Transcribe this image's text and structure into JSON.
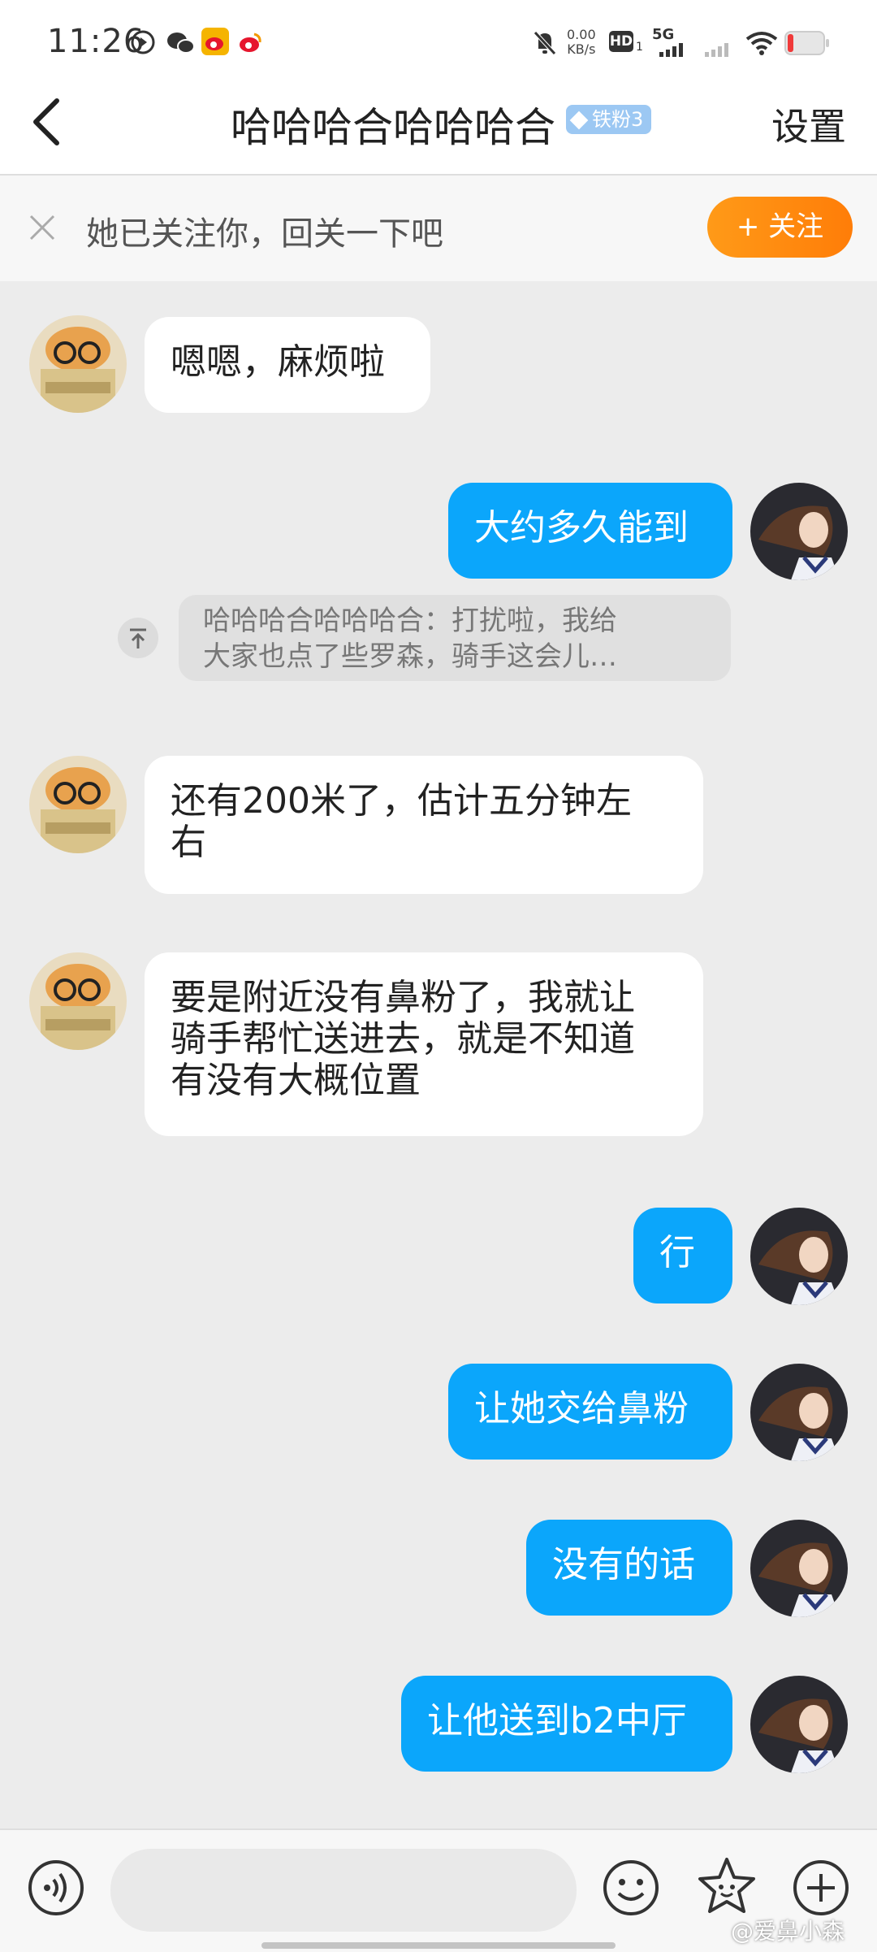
{
  "status_bar": {
    "time": "11:26",
    "net_speed_value": "0.00",
    "net_speed_unit": "KB/s",
    "hd_label": "HD",
    "hd_sub": "1",
    "network": "5G"
  },
  "header": {
    "title": "哈哈哈合哈哈哈合",
    "badge": "铁粉3",
    "settings_label": "设置"
  },
  "follow_banner": {
    "text": "她已关注你，回关一下吧",
    "button_label": "+ 关注"
  },
  "messages": [
    {
      "side": "left",
      "text": "嗯嗯，麻烦啦"
    },
    {
      "side": "right",
      "text": "大约多久能到"
    },
    {
      "side": "quote",
      "text_line1": "哈哈哈合哈哈哈合：打扰啦，我给",
      "text_line2": "大家也点了些罗森，骑手这会儿…"
    },
    {
      "side": "left",
      "text_line1": "还有200米了，估计五分钟左",
      "text_line2": "右"
    },
    {
      "side": "left",
      "text_line1": "要是附近没有鼻粉了，我就让",
      "text_line2": "骑手帮忙送进去，就是不知道",
      "text_line3": "有没有大概位置"
    },
    {
      "side": "right",
      "text": "行"
    },
    {
      "side": "right",
      "text": "让她交给鼻粉"
    },
    {
      "side": "right",
      "text": "没有的话"
    },
    {
      "side": "right",
      "text": "让他送到b2中厅"
    }
  ],
  "input_bar": {
    "placeholder": ""
  },
  "watermark": "@爱鼻小森",
  "colors": {
    "accent": "#0ba6fb",
    "follow_button": "#ff8a10",
    "badge": "#9cc8f3"
  },
  "icons": [
    "back-arrow-icon",
    "close-icon",
    "voice-icon",
    "emoji-icon",
    "sticker-icon",
    "plus-icon",
    "quote-jump-icon"
  ]
}
